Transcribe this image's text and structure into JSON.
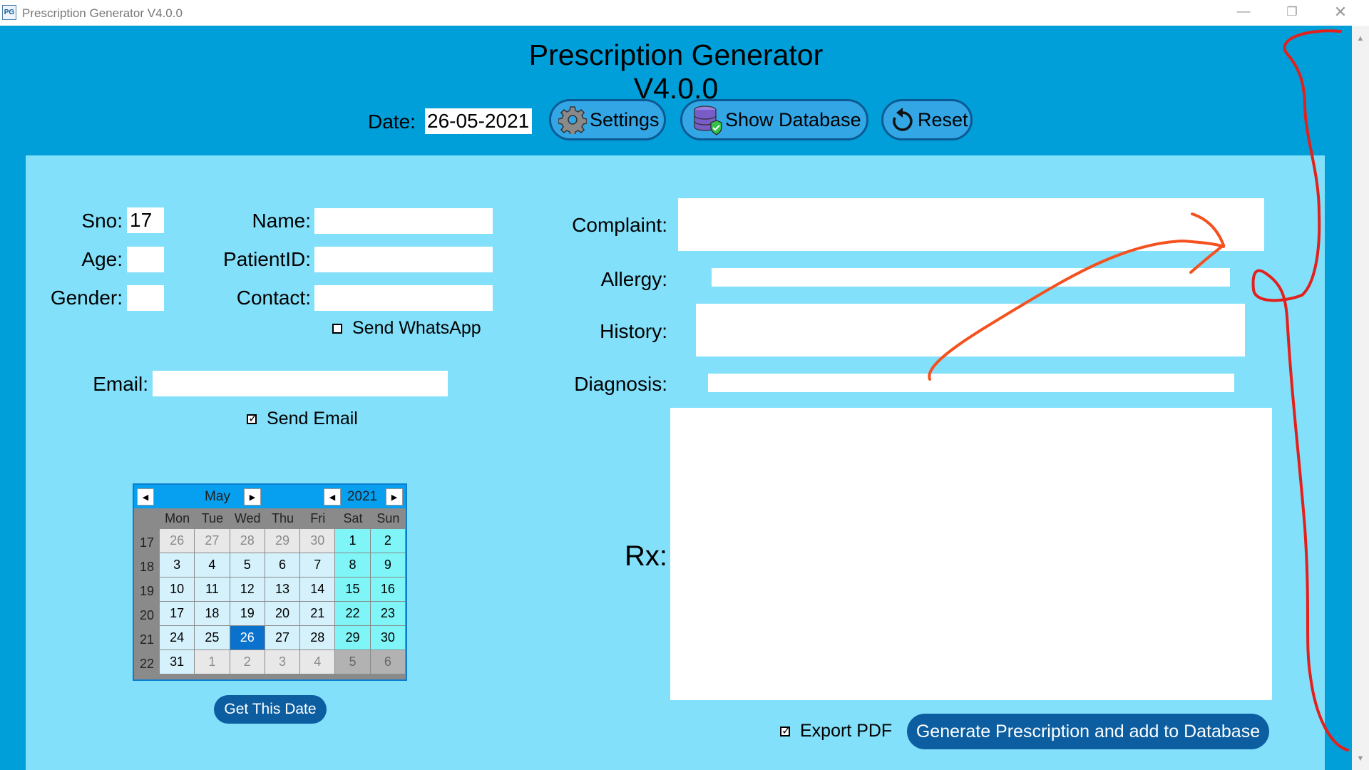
{
  "window": {
    "title": "Prescription Generator V4.0.0",
    "icon_text": "PG",
    "minimize": "—",
    "maximize": "❐",
    "close": "✕"
  },
  "header": {
    "title": "Prescription Generator V4.0.0",
    "date_label": "Date:",
    "date_value": "26-05-2021",
    "settings_label": "Settings",
    "show_database_label": "Show Database",
    "reset_label": "Reset"
  },
  "patient": {
    "sno_label": "Sno:",
    "sno_value": "17",
    "age_label": "Age:",
    "age_value": "",
    "gender_label": "Gender:",
    "gender_value": "",
    "name_label": "Name:",
    "name_value": "",
    "patientid_label": "PatientID:",
    "patientid_value": "",
    "contact_label": "Contact:",
    "contact_value": "",
    "send_whatsapp_label": "Send WhatsApp",
    "send_whatsapp_checked": false,
    "email_label": "Email:",
    "email_value": "",
    "send_email_label": "Send Email",
    "send_email_checked": true
  },
  "clinical": {
    "complaint_label": "Complaint:",
    "complaint_value": "",
    "allergy_label": "Allergy:",
    "allergy_value": "",
    "history_label": "History:",
    "history_value": "",
    "diagnosis_label": "Diagnosis:",
    "diagnosis_value": "",
    "rx_label": "Rx:",
    "rx_value": ""
  },
  "calendar": {
    "month": "May",
    "year": "2021",
    "prev_glyph": "◀",
    "next_glyph": "▶",
    "weekday_headers": [
      "Mon",
      "Tue",
      "Wed",
      "Thu",
      "Fri",
      "Sat",
      "Sun"
    ],
    "weeks": [
      {
        "num": "17",
        "days": [
          {
            "d": "26",
            "other": true
          },
          {
            "d": "27",
            "other": true
          },
          {
            "d": "28",
            "other": true
          },
          {
            "d": "29",
            "other": true
          },
          {
            "d": "30",
            "other": true
          },
          {
            "d": "1"
          },
          {
            "d": "2"
          }
        ]
      },
      {
        "num": "18",
        "days": [
          {
            "d": "3"
          },
          {
            "d": "4"
          },
          {
            "d": "5"
          },
          {
            "d": "6"
          },
          {
            "d": "7"
          },
          {
            "d": "8"
          },
          {
            "d": "9"
          }
        ]
      },
      {
        "num": "19",
        "days": [
          {
            "d": "10"
          },
          {
            "d": "11"
          },
          {
            "d": "12"
          },
          {
            "d": "13"
          },
          {
            "d": "14"
          },
          {
            "d": "15"
          },
          {
            "d": "16"
          }
        ]
      },
      {
        "num": "20",
        "days": [
          {
            "d": "17"
          },
          {
            "d": "18"
          },
          {
            "d": "19"
          },
          {
            "d": "20"
          },
          {
            "d": "21"
          },
          {
            "d": "22"
          },
          {
            "d": "23"
          }
        ]
      },
      {
        "num": "21",
        "days": [
          {
            "d": "24"
          },
          {
            "d": "25"
          },
          {
            "d": "26",
            "selected": true
          },
          {
            "d": "27"
          },
          {
            "d": "28"
          },
          {
            "d": "29"
          },
          {
            "d": "30"
          }
        ]
      },
      {
        "num": "22",
        "days": [
          {
            "d": "31"
          },
          {
            "d": "1",
            "other": true
          },
          {
            "d": "2",
            "other": true
          },
          {
            "d": "3",
            "other": true
          },
          {
            "d": "4",
            "other": true
          },
          {
            "d": "5",
            "other": true
          },
          {
            "d": "6",
            "other": true
          }
        ]
      }
    ],
    "get_date_label": "Get This Date"
  },
  "footer": {
    "export_pdf_label": "Export PDF",
    "export_pdf_checked": true,
    "generate_label": "Generate Prescription and add to Database"
  },
  "colors": {
    "window_bg": "#009fda",
    "panel_bg": "#82e0fa",
    "button_dark": "#0c5ea1",
    "selected_day": "#0a72cc",
    "annotation_red": "#e3201b",
    "annotation_orange": "#f4511e"
  },
  "icons": {
    "settings": "gear-icon",
    "show_database": "database-icon",
    "reset": "refresh-icon"
  }
}
